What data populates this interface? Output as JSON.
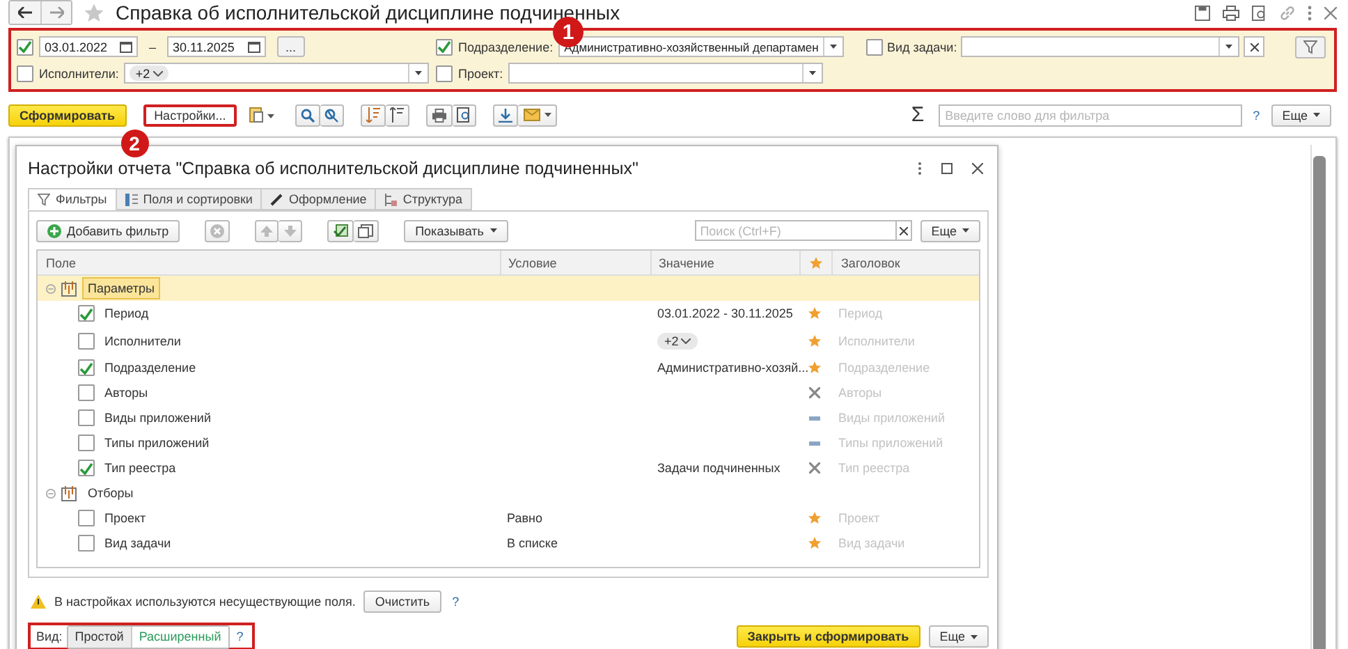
{
  "window": {
    "title": "Справка об исполнительской дисциплине подчиненных"
  },
  "annotations": [
    {
      "label": "1"
    },
    {
      "label": "2"
    }
  ],
  "filters": {
    "period": {
      "checked": true,
      "from": "03.01.2022",
      "separator": "–",
      "to": "30.11.2025",
      "more": "..."
    },
    "performers": {
      "checked": false,
      "label": "Исполнители:",
      "chip": "+2"
    },
    "department": {
      "checked": true,
      "label": "Подразделение:",
      "value": "Административно-хозяйственный департамен"
    },
    "project": {
      "checked": false,
      "label": "Проект:"
    },
    "task_type": {
      "checked": false,
      "label": "Вид задачи:"
    }
  },
  "toolbar": {
    "generate": "Сформировать",
    "settings": "Настройки...",
    "sigma": "Σ",
    "search_placeholder": "Введите слово для фильтра",
    "help": "?",
    "more": "Еще"
  },
  "dialog": {
    "title": "Настройки отчета \"Справка об исполнительской дисциплине подчиненных\"",
    "tabs": [
      {
        "label": "Фильтры",
        "selected": true
      },
      {
        "label": "Поля и сортировки",
        "selected": false
      },
      {
        "label": "Оформление",
        "selected": false
      },
      {
        "label": "Структура",
        "selected": false
      }
    ],
    "toolbar": {
      "add": "Добавить фильтр",
      "show": "Показывать",
      "search_placeholder": "Поиск (Ctrl+F)",
      "more": "Еще"
    },
    "columns": [
      "Поле",
      "Условие",
      "Значение",
      "Заголовок"
    ],
    "groups": [
      {
        "label": "Параметры",
        "expanded": true,
        "selected": true,
        "children": [
          {
            "field": "Период",
            "checked": true,
            "value": "03.01.2022 - 30.11.2025",
            "kind": "star",
            "title": "Период"
          },
          {
            "field": "Исполнители",
            "checked": false,
            "value_chip": "+2",
            "kind": "star",
            "title": "Исполнители"
          },
          {
            "field": "Подразделение",
            "checked": true,
            "value": "Административно-хозяй...",
            "kind": "star",
            "title": "Подразделение"
          },
          {
            "field": "Авторы",
            "checked": false,
            "kind": "cross",
            "title": "Авторы"
          },
          {
            "field": "Виды приложений",
            "checked": false,
            "kind": "dash",
            "title": "Виды приложений"
          },
          {
            "field": "Типы приложений",
            "checked": false,
            "kind": "dash",
            "title": "Типы приложений"
          },
          {
            "field": "Тип реестра",
            "checked": true,
            "value": "Задачи подчиненных",
            "kind": "cross",
            "title": "Тип реестра"
          }
        ]
      },
      {
        "label": "Отборы",
        "expanded": true,
        "selected": false,
        "children": [
          {
            "field": "Проект",
            "checked": false,
            "condition": "Равно",
            "kind": "star",
            "title": "Проект"
          },
          {
            "field": "Вид задачи",
            "checked": false,
            "condition": "В списке",
            "kind": "star",
            "title": "Вид задачи"
          }
        ]
      }
    ],
    "warning": "В настройках используются несуществующие поля.",
    "clear": "Очистить",
    "warning_help": "?",
    "view": {
      "label": "Вид:",
      "options": [
        {
          "label": "Простой",
          "selected": false
        },
        {
          "label": "Расширенный",
          "selected": true
        }
      ],
      "help": "?"
    },
    "close_generate": "Закрыть и сформировать",
    "more": "Еще"
  }
}
